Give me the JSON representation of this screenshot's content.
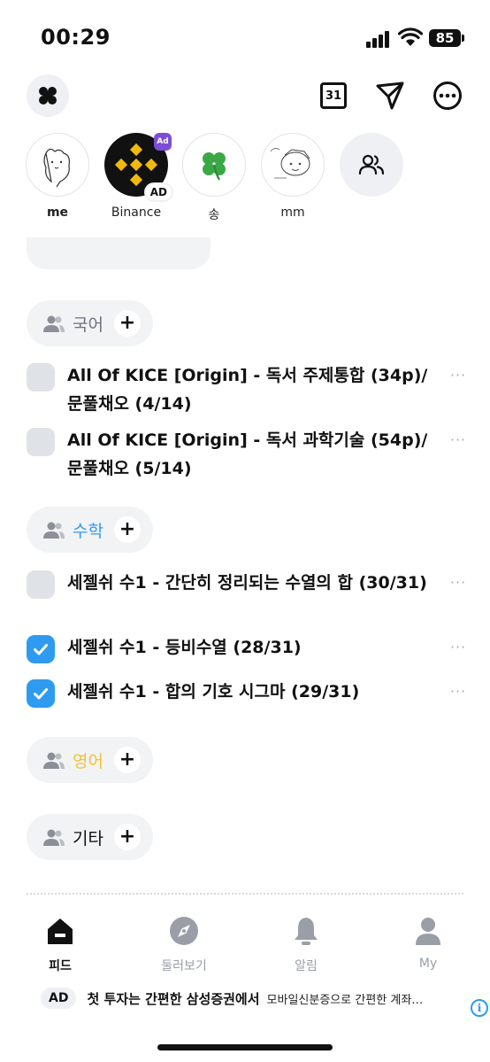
{
  "status": {
    "time": "00:29",
    "battery": "85"
  },
  "toolbar": {
    "calendar_number": "31"
  },
  "stories": [
    {
      "name": "me"
    },
    {
      "name": "Binance",
      "badge": "AD",
      "sticker": "Ad"
    },
    {
      "name": "송"
    },
    {
      "name": "mm"
    }
  ],
  "categories": [
    {
      "label": "국어",
      "color": "#6b7280",
      "todos": [
        {
          "text": "All Of KICE [Origin] - 독서 주제통합 (34p)/ 문풀채오 (4/14)",
          "done": false
        },
        {
          "text": "All Of KICE [Origin] - 독서 과학기술 (54p)/ 문풀채오 (5/14)",
          "done": false
        }
      ]
    },
    {
      "label": "수학",
      "color": "#2e9bf0",
      "todos": [
        {
          "text": "세젤쉬 수1 - 간단히 정리되는 수열의 합 (30/31)",
          "done": false
        },
        {
          "text": "세젤쉬 수1 - 등비수열 (28/31)",
          "done": true
        },
        {
          "text": "세젤쉬 수1 - 합의 기호 시그마 (29/31)",
          "done": true
        }
      ]
    },
    {
      "label": "영어",
      "color": "#f2c230",
      "todos": []
    },
    {
      "label": "기타",
      "color": "#111111",
      "todos": []
    }
  ],
  "more_glyph": "···",
  "plus_glyph": "+",
  "tabs": [
    {
      "label": "피드",
      "icon": "home-icon",
      "active": true
    },
    {
      "label": "둘러보기",
      "icon": "compass-icon",
      "active": false
    },
    {
      "label": "알림",
      "icon": "bell-icon",
      "active": false
    },
    {
      "label": "My",
      "icon": "person-icon",
      "active": false
    }
  ],
  "ad": {
    "tag": "AD",
    "headline": "첫 투자는 간편한 삼성증권에서",
    "description": "모바일신분증으로 간편한 계좌…",
    "info": "i"
  },
  "colors": {
    "accent": "#2e9bf0",
    "chip_bg": "#f2f3f5",
    "unchecked": "#dfe2e6"
  }
}
